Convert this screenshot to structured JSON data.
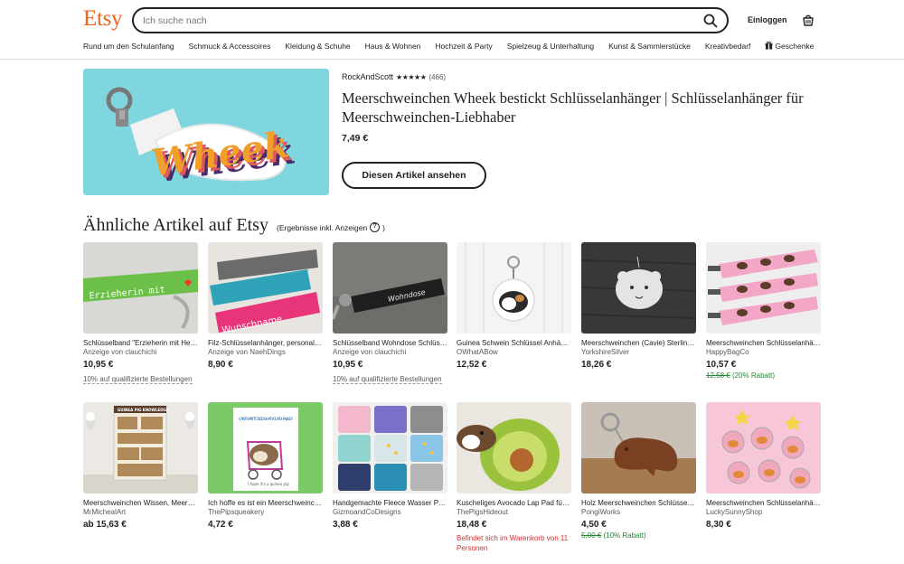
{
  "header": {
    "logo": "Etsy",
    "search_placeholder": "Ich suche nach",
    "signin": "Einloggen",
    "nav": [
      "Rund um den Schulanfang",
      "Schmuck & Accessoires",
      "Kleidung & Schuhe",
      "Haus & Wohnen",
      "Hochzeit & Party",
      "Spielzeug & Unterhaltung",
      "Kunst & Sammlerstücke",
      "Kreativbedarf",
      "Geschenke"
    ]
  },
  "featured": {
    "shop": "RockAndScott",
    "stars": "★★★★★",
    "reviews": "(466)",
    "title": "Meerschweinchen Wheek bestickt Schlüsselanhänger | Schlüsselanhänger für Meerschweinchen-Liebhaber",
    "price": "7,49 €",
    "button": "Diesen Artikel ansehen",
    "image_text": "Wheek"
  },
  "section": {
    "title": "Ähnliche Artikel auf Etsy",
    "note": "(Ergebnisse inkl. Anzeigen"
  },
  "items": [
    {
      "title": "Schlüsselband \"Erzieherin mit Herz\"",
      "shop": "Anzeige von clauchichi",
      "price": "10,95 €",
      "promo": "10% auf qualifizierte Bestellungen",
      "thumb_text": "Erzieherin mit"
    },
    {
      "title": "Filz-Schlüsselanhänger, personalisiert",
      "shop": "Anzeige von NaehDings",
      "price": "8,90 €",
      "thumb_text": "Wunschname"
    },
    {
      "title": "Schlüsselband Wohndose Schlüsselanhänger",
      "shop": "Anzeige von clauchichi",
      "price": "10,95 €",
      "promo": "10% auf qualifizierte Bestellungen",
      "thumb_text": "Wohndose"
    },
    {
      "title": "Guinea Schwein Schlüssel Anhänger",
      "shop": "OWhatABow",
      "price": "12,52 €"
    },
    {
      "title": "Meerschweinchen (Cavie) Sterling Silber",
      "shop": "YorkshireSilver",
      "price": "18,26 €"
    },
    {
      "title": "Meerschweinchen Schlüsselanhänger",
      "shop": "HappyBagCo",
      "price": "10,57 €",
      "old_price": "12,58 €",
      "discount": "(20% Rabatt)"
    },
    {
      "title": "Meerschweinchen Wissen, Meerschweinchen Poster",
      "shop": "MrMichealArt",
      "price": "ab 15,63 €",
      "thumb_text": "GUINEA PIG KNOWLEDGE"
    },
    {
      "title": "Ich hoffe es ist ein Meerschweinchen Karte",
      "shop": "ThePipsqueakery",
      "price": "4,72 €",
      "thumb_text": "CAN'T WAIT TO SEE WHAT YOU'RE HAVING!",
      "thumb_text2": "I hope it's a guinea pig"
    },
    {
      "title": "Handgemachte Fleece Wasser Pads",
      "shop": "GizmoandCoDesigns",
      "price": "3,88 €"
    },
    {
      "title": "Kuscheliges Avocado Lap Pad für Meerschweinchen",
      "shop": "ThePigsHideout",
      "price": "18,48 €",
      "cart_note": "Befindet sich im Warenkorb von 11 Personen"
    },
    {
      "title": "Holz Meerschweinchen Schlüsselanhänger",
      "shop": "PongiWorks",
      "price": "4,50 €",
      "old_price": "5,00 €",
      "discount": "(10% Rabatt)"
    },
    {
      "title": "Meerschweinchen Schlüsselanhänger Acryl",
      "shop": "LuckySunnyShop",
      "price": "8,30 €"
    }
  ],
  "colors": {
    "brand": "#f1641e",
    "discount": "#258635",
    "alert": "#d32f2f",
    "featured_bg": "#7fd6de"
  }
}
